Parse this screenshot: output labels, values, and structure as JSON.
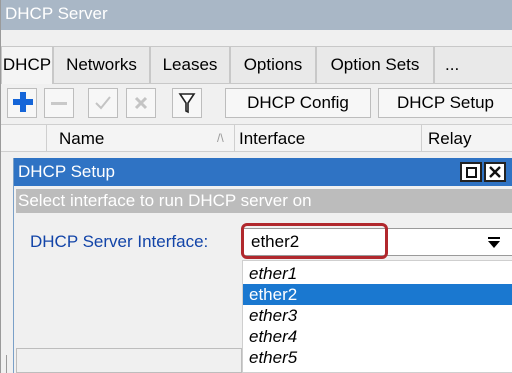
{
  "window": {
    "title": "DHCP Server"
  },
  "tabs": [
    "DHCP",
    "Networks",
    "Leases",
    "Options",
    "Option Sets",
    "..."
  ],
  "toolbar": {
    "add_icon": "plus-icon",
    "remove_icon": "minus-icon",
    "enable_icon": "check-icon",
    "disable_icon": "cross-icon",
    "filter_icon": "filter-icon",
    "config_label": "DHCP Config",
    "setup_label": "DHCP Setup"
  },
  "columns": {
    "name": "Name",
    "sort_marker": "/\\",
    "interface": "Interface",
    "relay": "Relay"
  },
  "dialog": {
    "title": "DHCP Setup",
    "subtitle": "Select interface to run DHCP server on",
    "field_label": "DHCP Server Interface:",
    "field_value": "ether2",
    "options": [
      "ether1",
      "ether2",
      "ether3",
      "ether4",
      "ether5"
    ],
    "selected_index": 1
  },
  "colors": {
    "title_bar": "#a9b7c6",
    "dialog_title": "#2f73c4",
    "selection": "#1a78d0",
    "highlight_ring": "#b1282d",
    "label_blue": "#1244a8"
  }
}
